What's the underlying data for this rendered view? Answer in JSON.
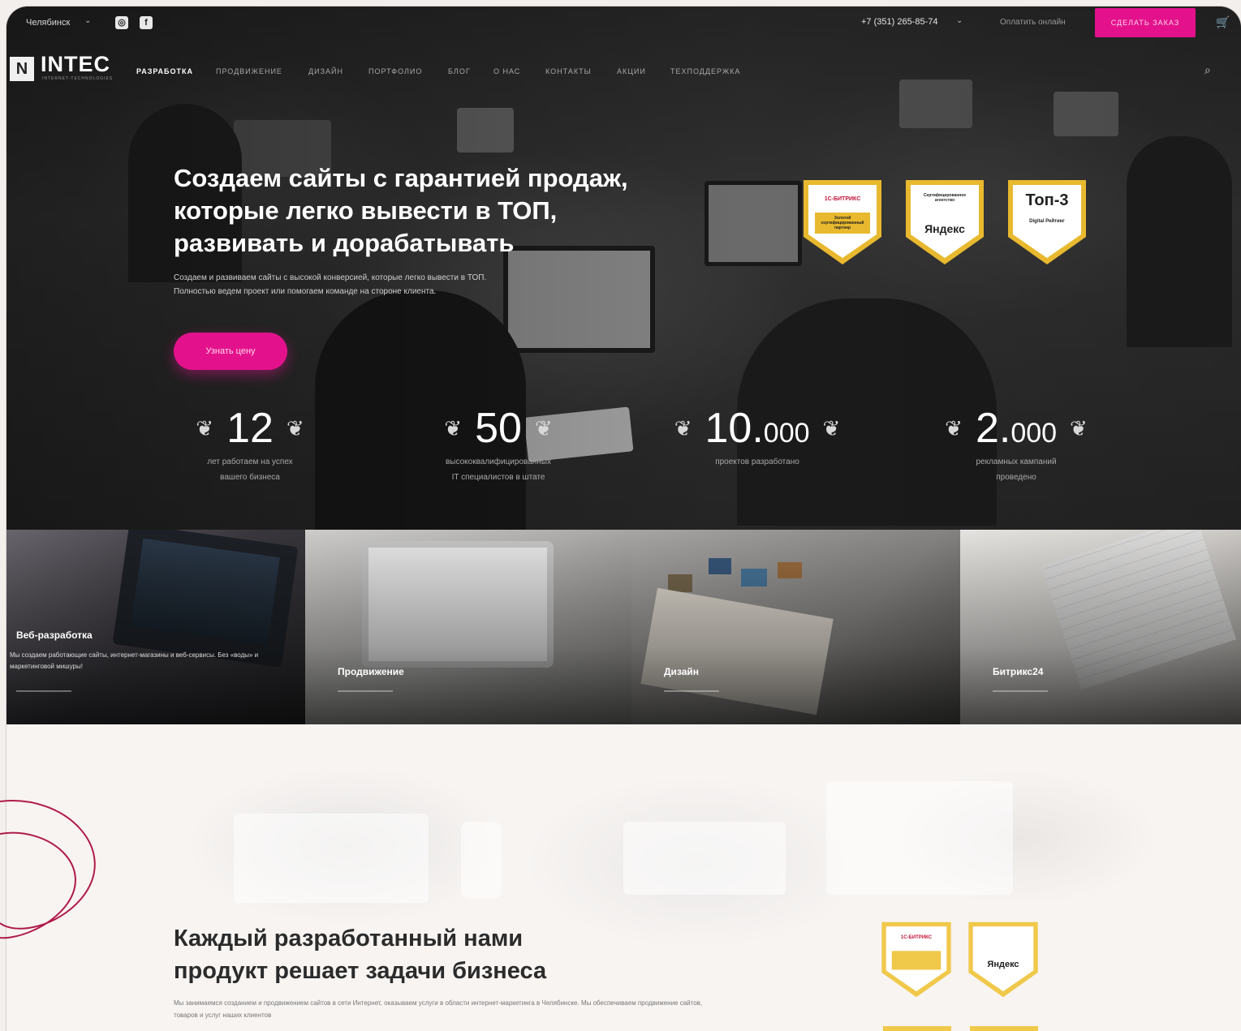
{
  "topbar": {
    "city": "Челябинск",
    "social": [
      "instagram-icon",
      "facebook-icon"
    ],
    "phone": "+7 (351) 265-85-74",
    "pay_online": "Оплатить онлайн",
    "order_button": "СДЕЛАТЬ ЗАКАЗ"
  },
  "logo": {
    "mark": "N",
    "name": "INTEC",
    "tagline": "INTERNET-TECHNOLOGIES"
  },
  "nav": {
    "items": [
      "РАЗРАБОТКА",
      "ПРОДВИЖЕНИЕ",
      "ДИЗАЙН",
      "ПОРТФОЛИО",
      "БЛОГ",
      "О НАС",
      "КОНТАКТЫ",
      "АКЦИИ",
      "ТЕХПОДДЕРЖКА"
    ],
    "active_index": 0
  },
  "hero": {
    "title_lines": [
      "Создаем сайты с гарантией продаж,",
      "которые легко вывести в ТОП,",
      "развивать и дорабатывать"
    ],
    "description": "Создаем и развиваем сайты с высокой конверсией, которые легко вывести в ТОП. Полностью ведем проект или помогаем команде на стороне клиента.",
    "cta": "Узнать цену"
  },
  "badges": [
    {
      "brand": "1С-БИТРИКС",
      "text": "Золотой сертифицированный партнер"
    },
    {
      "brand": "Яндекс",
      "text": "Сертифицированное агентство"
    },
    {
      "brand": "Топ-3",
      "text": "Digital Рейтинг"
    }
  ],
  "stats": [
    {
      "value": "12",
      "suffix": "",
      "label_lines": [
        "лет работаем на успех",
        "вашего бизнеса"
      ]
    },
    {
      "value": "50",
      "suffix": "",
      "label_lines": [
        "высококвалифицированных",
        "IT специалистов в штате"
      ]
    },
    {
      "value": "10.",
      "suffix": "000",
      "label_lines": [
        "проектов разработано"
      ]
    },
    {
      "value": "2.",
      "suffix": "000",
      "label_lines": [
        "рекламных кампаний",
        "проведено"
      ]
    }
  ],
  "services": [
    {
      "title": "Веб-разработка",
      "description": "Мы создаем работающие сайты, интернет-магазины и веб-сервисы. Без «воды» и маркетинговой мишуры!"
    },
    {
      "title": "Продвижение"
    },
    {
      "title": "Дизайн"
    },
    {
      "title": "Битрикс24"
    }
  ],
  "about": {
    "title_lines": [
      "Каждый разработанный нами",
      "продукт решает задачи бизнеса"
    ],
    "text": "Мы занимаемся созданием и продвижением сайтов в сети Интернет, оказываем услуги в области интернет-маркетинга в Челябинске. Мы обеспечиваем продвижение сайтов, товаров и услуг наших клиентов"
  },
  "colors": {
    "accent": "#e3128c",
    "badge_gold": "#e8b92f"
  }
}
